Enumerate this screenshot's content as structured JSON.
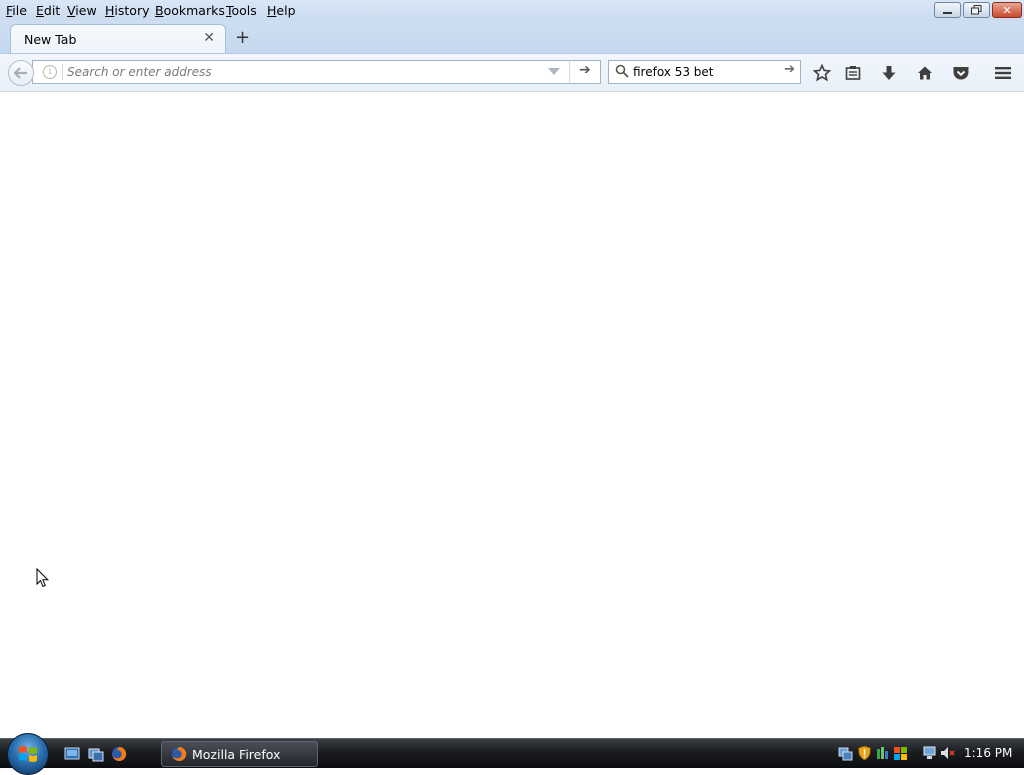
{
  "menubar": {
    "items": [
      "File",
      "Edit",
      "View",
      "History",
      "Bookmarks",
      "Tools",
      "Help"
    ]
  },
  "tabs": [
    {
      "label": "New Tab",
      "active": true
    }
  ],
  "navbar": {
    "url_placeholder": "Search or enter address",
    "url_value": "",
    "search_value": "firefox 53 bet"
  },
  "taskbar": {
    "window_button_label": "Mozilla Firefox",
    "clock": "1:16 PM"
  },
  "icons": {
    "back": "back-arrow-icon",
    "info": "info-icon",
    "go": "go-arrow-icon",
    "search": "search-icon",
    "bookmark_star": "star-icon",
    "reading_list": "bookmarks-menu-icon",
    "downloads": "download-icon",
    "home": "home-icon",
    "pocket": "pocket-icon",
    "menu": "hamburger-menu-icon"
  },
  "colors": {
    "chrome_bg": "#dbe7f5",
    "taskbar_bg": "#1a1c20",
    "close_button": "#c94a2c"
  }
}
